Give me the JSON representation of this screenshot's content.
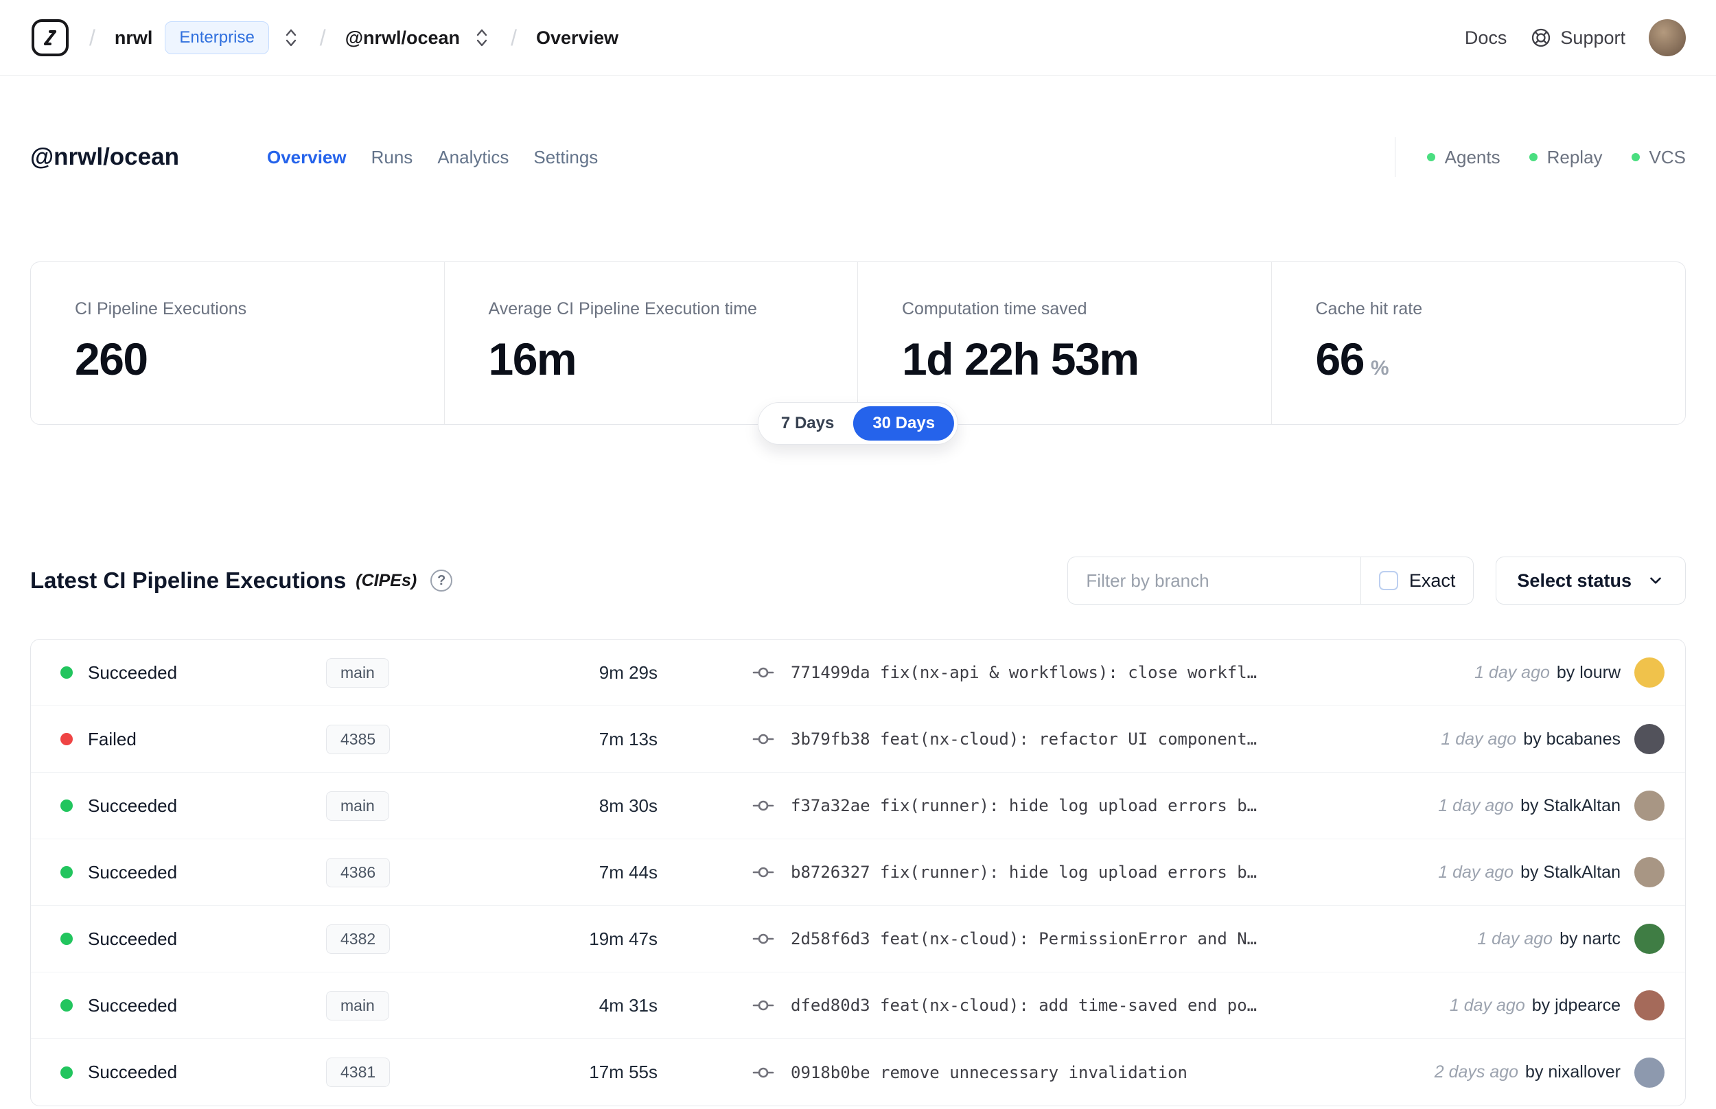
{
  "colors": {
    "accent": "#2563eb",
    "success_dot": "#22c55e",
    "failed_dot": "#ef4444",
    "env_dot": "#4ade80",
    "badge_text": "#2f6fde"
  },
  "icons": {
    "logo": "nx-cloud-logo",
    "breadcrumb_switcher": "up-down-chevron-icon",
    "support": "lifebuoy-icon",
    "help": "question-circle-icon",
    "commit": "git-commit-icon",
    "select": "chevron-down-icon"
  },
  "navbar": {
    "separator": "/",
    "org": "nrwl",
    "org_badge": "Enterprise",
    "workspace": "@nrwl/ocean",
    "page": "Overview",
    "docs_link": "Docs",
    "support_link": "Support"
  },
  "header": {
    "title": "@nrwl/ocean",
    "tabs": [
      {
        "label": "Overview",
        "active": true
      },
      {
        "label": "Runs",
        "active": false
      },
      {
        "label": "Analytics",
        "active": false
      },
      {
        "label": "Settings",
        "active": false
      }
    ],
    "env_statuses": [
      {
        "label": "Agents"
      },
      {
        "label": "Replay"
      },
      {
        "label": "VCS"
      }
    ]
  },
  "stats": [
    {
      "label": "CI Pipeline Executions",
      "value": "260"
    },
    {
      "label": "Average CI Pipeline Execution time",
      "value": "16m"
    },
    {
      "label": "Computation time saved",
      "value": "1d 22h 53m"
    },
    {
      "label": "Cache hit rate",
      "value": "66",
      "suffix": "%"
    }
  ],
  "range_toggle": [
    {
      "label": "7 Days",
      "active": false
    },
    {
      "label": "30 Days",
      "active": true
    }
  ],
  "cipe_section": {
    "title": "Latest CI Pipeline Executions",
    "subtitle": "(CIPEs)",
    "help_glyph": "?",
    "filter_placeholder": "Filter by branch",
    "exact_label": "Exact",
    "status_select_label": "Select status"
  },
  "table": {
    "rows": [
      {
        "status": "Succeeded",
        "state": "success",
        "branch": "main",
        "duration": "9m 29s",
        "commit": "771499da fix(nx-api & workflows): close workfl…",
        "time": "1 day ago",
        "author": "by lourw",
        "avatar_color": "#f0c24b"
      },
      {
        "status": "Failed",
        "state": "failed",
        "branch": "4385",
        "duration": "7m 13s",
        "commit": "3b79fb38 feat(nx-cloud): refactor UI component…",
        "time": "1 day ago",
        "author": "by bcabanes",
        "avatar_color": "#52525b"
      },
      {
        "status": "Succeeded",
        "state": "success",
        "branch": "main",
        "duration": "8m 30s",
        "commit": "f37a32ae fix(runner): hide log upload errors b…",
        "time": "1 day ago",
        "author": "by StalkAltan",
        "avatar_color": "#a89684"
      },
      {
        "status": "Succeeded",
        "state": "success",
        "branch": "4386",
        "duration": "7m 44s",
        "commit": "b8726327 fix(runner): hide log upload errors b…",
        "time": "1 day ago",
        "author": "by StalkAltan",
        "avatar_color": "#a89684"
      },
      {
        "status": "Succeeded",
        "state": "success",
        "branch": "4382",
        "duration": "19m 47s",
        "commit": "2d58f6d3 feat(nx-cloud): PermissionError and N…",
        "time": "1 day ago",
        "author": "by nartc",
        "avatar_color": "#3f7d44"
      },
      {
        "status": "Succeeded",
        "state": "success",
        "branch": "main",
        "duration": "4m 31s",
        "commit": "dfed80d3 feat(nx-cloud): add time-saved end po…",
        "time": "1 day ago",
        "author": "by jdpearce",
        "avatar_color": "#a56a5a"
      },
      {
        "status": "Succeeded",
        "state": "success",
        "branch": "4381",
        "duration": "17m 55s",
        "commit": "0918b0be remove unnecessary invalidation",
        "time": "2 days ago",
        "author": "by nixallover",
        "avatar_color": "#8d99ae"
      }
    ]
  }
}
